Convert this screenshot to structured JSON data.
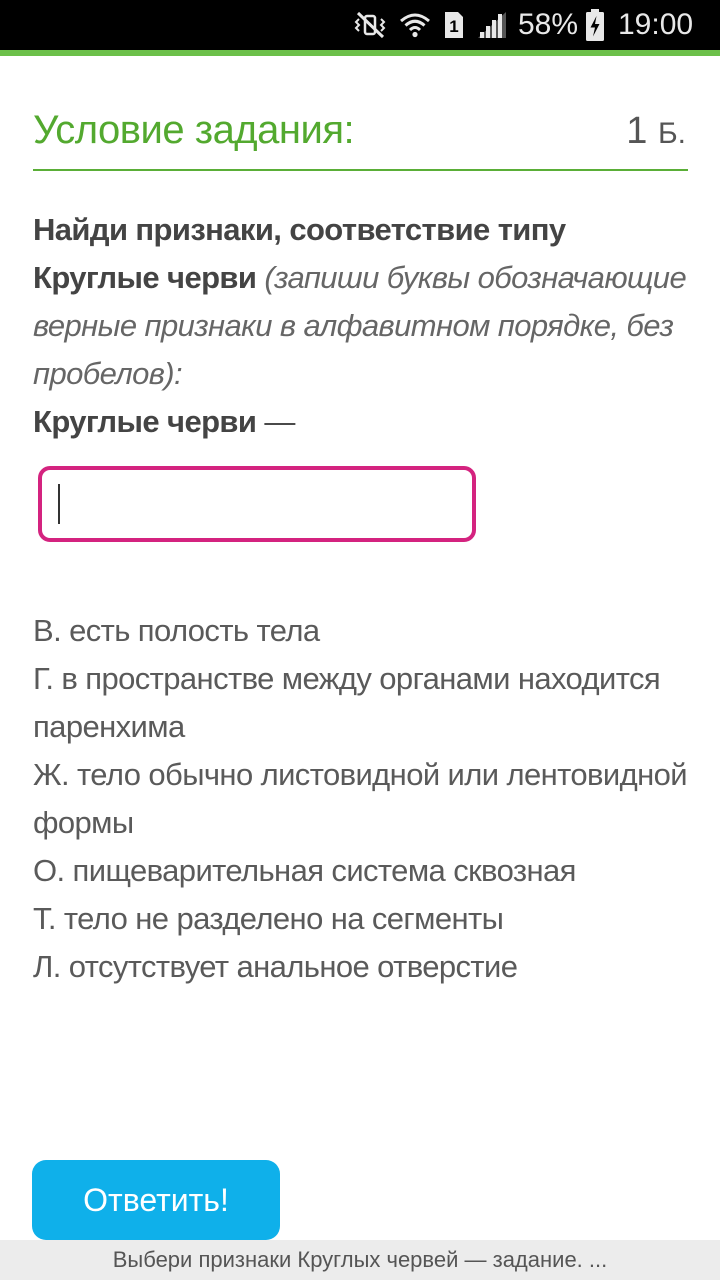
{
  "status_bar": {
    "battery_percent": "58%",
    "time": "19:00",
    "sim_slot": "1",
    "icons": [
      "mute-vibrate-icon",
      "wifi-icon",
      "sim-icon",
      "signal-icon",
      "battery-charging-icon"
    ]
  },
  "header": {
    "title": "Условие задания:",
    "points_value": "1",
    "points_unit": "Б."
  },
  "task": {
    "line1": "Найди признаки, соответствие типу",
    "type_name": "Круглые черви",
    "hint": "(запиши буквы обозначающие верные признаки в алфавитном порядке, без пробелов):",
    "answer_prompt": "Круглые черви",
    "dash": " —"
  },
  "answer_input": {
    "value": ""
  },
  "options": [
    "В. есть полость тела",
    "Г. в пространстве между органами находится паренхима",
    "Ж. тело обычно листовидной или лентовидной формы",
    "О. пищеварительная система сквозная",
    "Т. тело не разделено на сегменты",
    "Л. отсутствует анальное отверстие"
  ],
  "submit_button": {
    "label": "Ответить!"
  },
  "bottom_bar": {
    "text": "Выбери признаки Круглых червей — задание. ..."
  },
  "colors": {
    "accent_green": "#5aae37",
    "input_border": "#d4237f",
    "button_blue": "#0fb0ea"
  }
}
